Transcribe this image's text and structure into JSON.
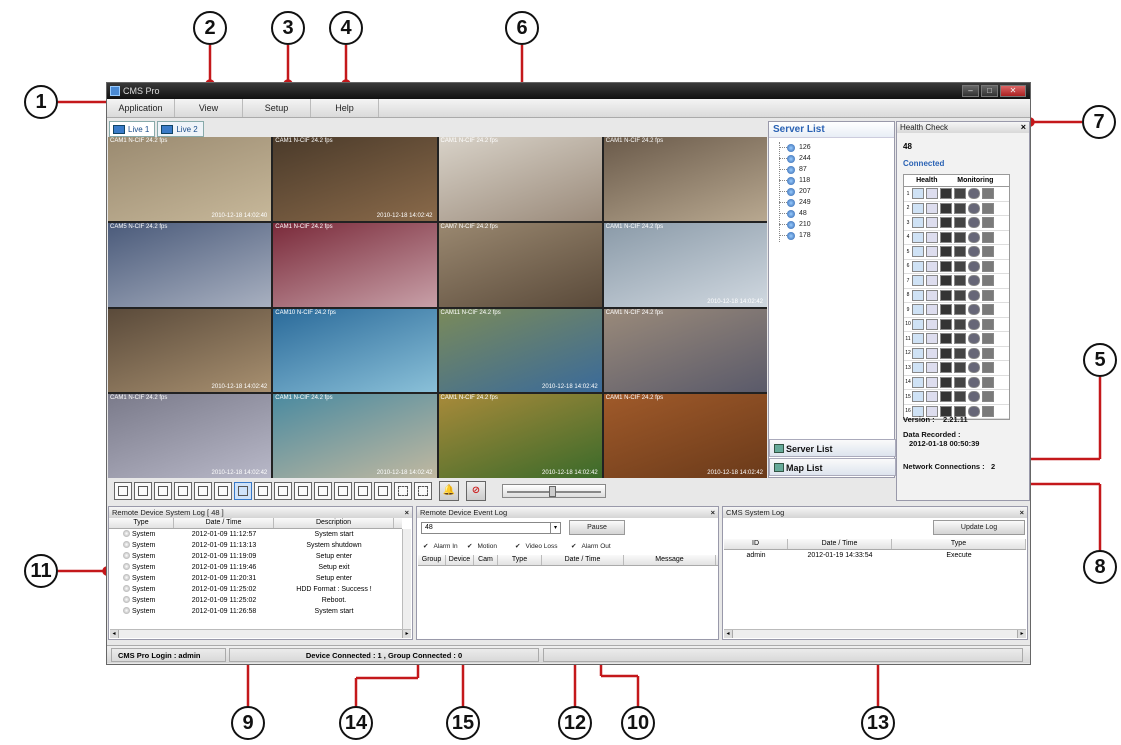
{
  "window": {
    "title": "CMS Pro"
  },
  "menu": [
    "Application",
    "View",
    "Setup",
    "Help"
  ],
  "tabs": [
    "Live 1",
    "Live 2"
  ],
  "cameras": [
    {
      "label": "CAM1 N-CIF 24.2 fps",
      "time": "2010-12-18  14:02:40"
    },
    {
      "label": "CAM1 N-CIF 24.2 fps",
      "time": "2010-12-18  14:02:42"
    },
    {
      "label": "CAM1 N-CIF 24.2 fps",
      "time": ""
    },
    {
      "label": "CAM1 N-CIF 24.2 fps",
      "time": ""
    },
    {
      "label": "CAM5 N-CIF 24.2 fps",
      "time": ""
    },
    {
      "label": "CAM1 N-CIF 24.2 fps",
      "time": ""
    },
    {
      "label": "CAM7 N-CIF 24.2 fps",
      "time": ""
    },
    {
      "label": "CAM1 N-CIF 24.2 fps",
      "time": "2010-12-18  14:02:42"
    },
    {
      "label": "",
      "time": "2010-12-18  14:02:42"
    },
    {
      "label": "CAM10 N-CIF 24.2 fps",
      "time": ""
    },
    {
      "label": "CAM11 N-CIF 24.2 fps",
      "time": "2010-12-18  14:02:42"
    },
    {
      "label": "CAM1 N-CIF 24.2 fps",
      "time": ""
    },
    {
      "label": "CAM1 N-CIF 24.2 fps",
      "time": "2010-12-18  14:02:42"
    },
    {
      "label": "CAM1 N-CIF 24.2 fps",
      "time": "2010-12-18  14:02:42"
    },
    {
      "label": "CAM1 N-CIF 24.2 fps",
      "time": "2010-12-18  14:02:42"
    },
    {
      "label": "CAM1 N-CIF 24.2 fps",
      "time": "2010-12-18  14:02:42"
    }
  ],
  "server_list": {
    "title": "Server List",
    "servers": [
      "126",
      "244",
      "87",
      "118",
      "207",
      "249",
      "48",
      "210",
      "178"
    ],
    "buttons": [
      "Server List",
      "Map List"
    ]
  },
  "health_check": {
    "title": "Health Check",
    "server_id": "48",
    "state": "Connected",
    "col_health": "Health",
    "col_monitoring": "Monitoring",
    "rows": [
      "1",
      "2",
      "3",
      "4",
      "5",
      "6",
      "7",
      "8",
      "9",
      "10",
      "11",
      "12",
      "13",
      "14",
      "15",
      "16"
    ],
    "version_label": "Version :",
    "version": "2.21.11",
    "data_recorded_label": "Data Recorded :",
    "data_recorded": "2012-01-18 00:50:39",
    "network_label": "Network Connections :",
    "network": "2"
  },
  "system_log": {
    "title": "Remote Device System Log  [ 48 ]",
    "columns": [
      "Type",
      "Date / Time",
      "Description"
    ],
    "rows": [
      {
        "type": "System",
        "time": "2012-01-09 11:12:57",
        "desc": "System start"
      },
      {
        "type": "System",
        "time": "2012-01-09 11:13:13",
        "desc": "System shutdown"
      },
      {
        "type": "System",
        "time": "2012-01-09 11:19:09",
        "desc": "Setup enter"
      },
      {
        "type": "System",
        "time": "2012-01-09 11:19:46",
        "desc": "Setup exit"
      },
      {
        "type": "System",
        "time": "2012-01-09 11:20:31",
        "desc": "Setup enter"
      },
      {
        "type": "System",
        "time": "2012-01-09 11:25:02",
        "desc": "HDD Format : Success !"
      },
      {
        "type": "System",
        "time": "2012-01-09 11:25:02",
        "desc": "Reboot."
      },
      {
        "type": "System",
        "time": "2012-01-09 11:26:58",
        "desc": "System start"
      }
    ]
  },
  "event_log": {
    "title": "Remote Device Event Log",
    "select_value": "48",
    "pause_label": "Pause",
    "checks": [
      "Alarm In",
      "Motion",
      "Video Loss",
      "Alarm Out"
    ],
    "columns": [
      "Group",
      "Device",
      "Cam",
      "Type",
      "Date / Time",
      "Message"
    ]
  },
  "cms_log": {
    "title": "CMS System Log",
    "update_label": "Update Log",
    "columns": [
      "ID",
      "Date / Time",
      "Type"
    ],
    "rows": [
      {
        "id": "admin",
        "time": "2012-01-19 14:33:54",
        "type": "Execute"
      }
    ]
  },
  "status": {
    "login": "CMS Pro Login : admin",
    "connected": "Device Connected : 1 , Group Connected : 0"
  },
  "callouts": [
    "1",
    "2",
    "3",
    "4",
    "5",
    "6",
    "7",
    "8",
    "9",
    "10",
    "11",
    "12",
    "13",
    "14",
    "15"
  ]
}
